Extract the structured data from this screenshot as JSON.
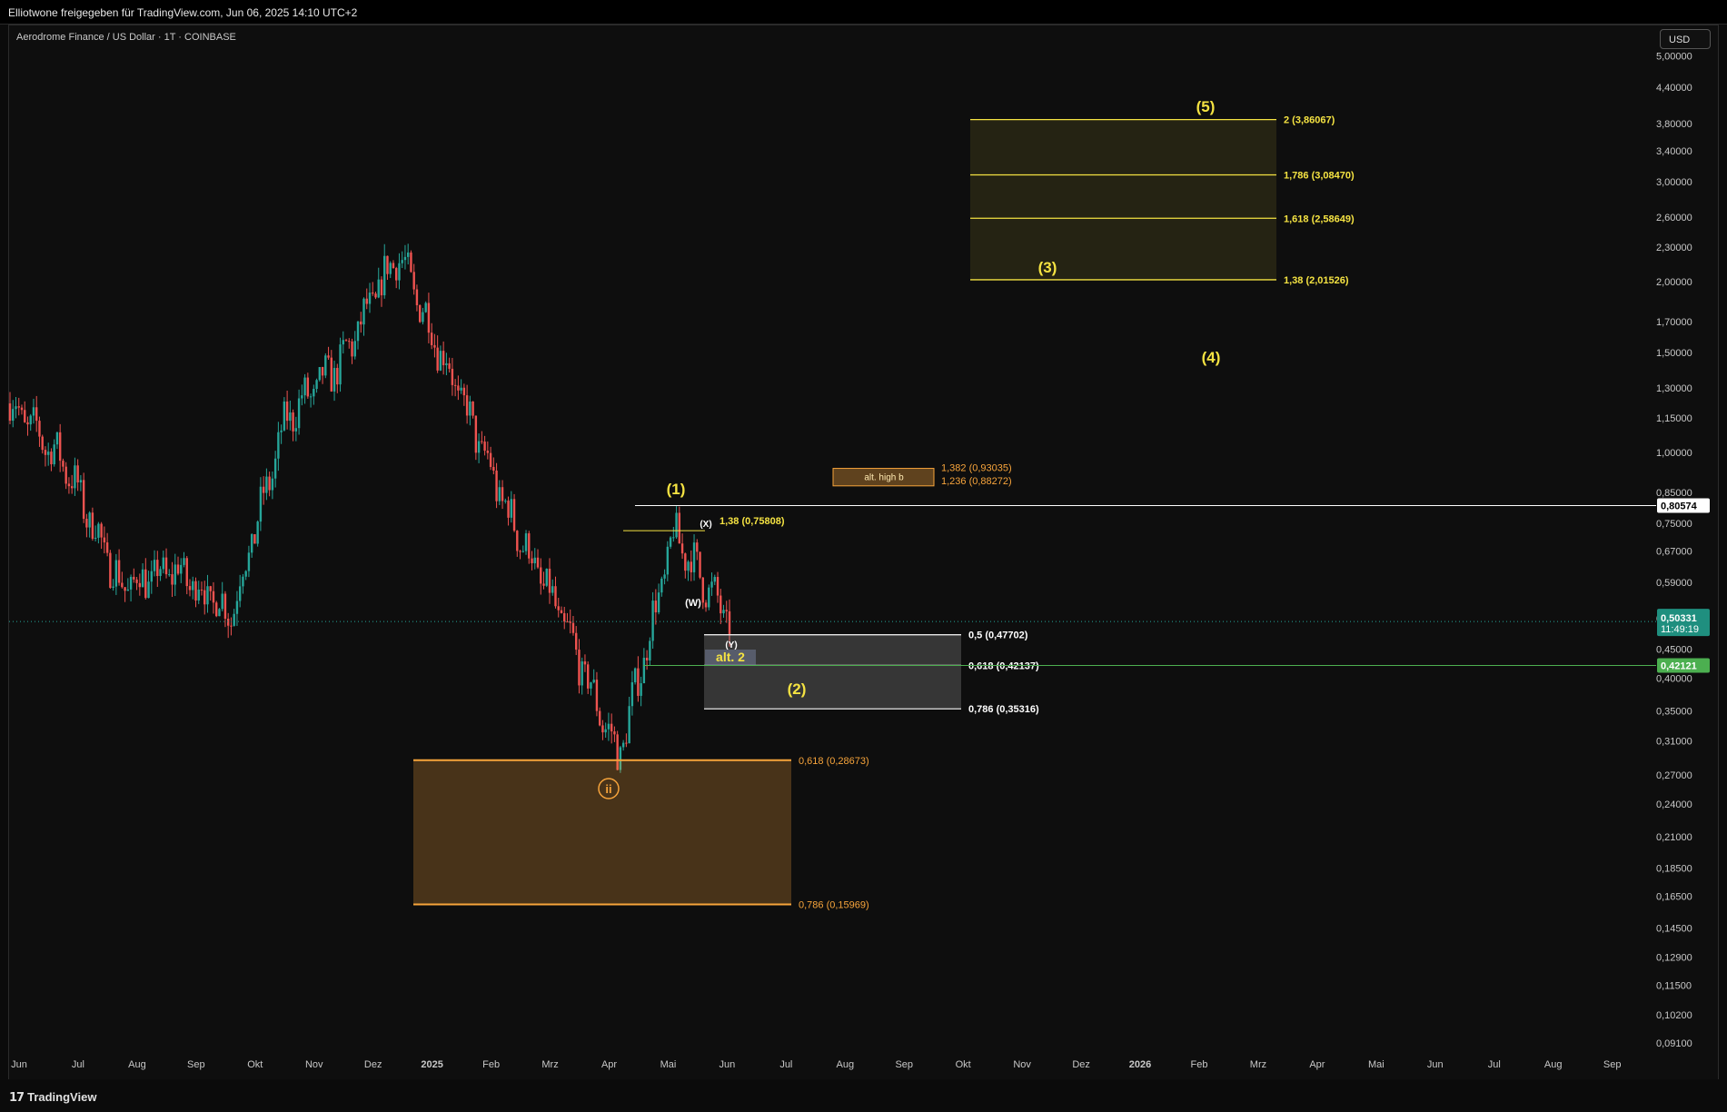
{
  "header": {
    "share_text": "Elliotwone freigegeben für TradingView.com, Jun 06, 2025 14:10 UTC+2"
  },
  "symbol": "Aerodrome Finance / US Dollar · 1T · COINBASE",
  "currency_button": "USD",
  "footer": {
    "brand": "TradingView"
  },
  "colors": {
    "up": "#26a69a",
    "down": "#ef5350",
    "fib_yellow": "#f5e342",
    "fib_orange": "#f7a43b",
    "white": "#ffffff",
    "green": "#4caf50"
  },
  "chart_data": {
    "type": "candlestick",
    "scale": "log",
    "ylim": [
      0.085,
      5.1
    ],
    "x_ticks": [
      "Jun",
      "Jul",
      "Aug",
      "Sep",
      "Okt",
      "Nov",
      "Dez",
      "2025",
      "Feb",
      "Mrz",
      "Apr",
      "Mai",
      "Jun",
      "Jul",
      "Aug",
      "Sep",
      "Okt",
      "Nov",
      "Dez",
      "2026",
      "Feb",
      "Mrz",
      "Apr",
      "Mai",
      "Jun",
      "Jul",
      "Aug",
      "Sep"
    ],
    "y_ticks": [
      "5,00000",
      "4,40000",
      "3,80000",
      "3,40000",
      "3,00000",
      "2,60000",
      "2,30000",
      "2,00000",
      "1,70000",
      "1,50000",
      "1,30000",
      "1,15000",
      "1,00000",
      "0,85000",
      "0,75000",
      "0,67000",
      "0,59000",
      "0,51000",
      "0,45000",
      "0,40000",
      "0,35000",
      "0,31000",
      "0,27000",
      "0,24000",
      "0,21000",
      "0,18500",
      "0,16500",
      "0,14500",
      "0,12900",
      "0,11500",
      "0,10200",
      "0,09100"
    ],
    "y_tick_values": [
      5.0,
      4.4,
      3.8,
      3.4,
      3.0,
      2.6,
      2.3,
      2.0,
      1.7,
      1.5,
      1.3,
      1.15,
      1.0,
      0.85,
      0.75,
      0.67,
      0.59,
      0.51,
      0.45,
      0.4,
      0.35,
      0.31,
      0.27,
      0.24,
      0.21,
      0.185,
      0.165,
      0.145,
      0.129,
      0.115,
      0.102,
      0.091
    ],
    "price_path_months": [
      "Jun",
      "Jul",
      "Aug",
      "Sep",
      "Okt",
      "Nov",
      "Dez",
      "2025",
      "Feb",
      "Mrz",
      "Apr",
      "Mai",
      "Jun"
    ],
    "price_path_values": [
      1.22,
      0.95,
      0.58,
      0.62,
      0.52,
      1.15,
      1.45,
      2.25,
      1.35,
      0.78,
      0.5,
      0.29,
      0.72,
      0.5
    ],
    "last_price": {
      "value": "0,50331",
      "countdown": "11:49:19"
    },
    "labels_right": [
      {
        "text": "0,80574",
        "value": 0.80574,
        "style": "white"
      },
      {
        "text": "0,42121",
        "value": 0.42121,
        "style": "green"
      }
    ],
    "horizontal_lines": [
      {
        "value": 0.80574,
        "color": "#ffffff"
      },
      {
        "value": 0.42121,
        "color": "#4caf50"
      },
      {
        "value": 0.50331,
        "color": "#26a69a",
        "dotted": true
      }
    ],
    "fib_targets_yellow": [
      {
        "label": "2 (3,86067)",
        "value": 3.86067
      },
      {
        "label": "1,786 (3,08470)",
        "value": 3.0847
      },
      {
        "label": "1,618 (2,58649)",
        "value": 2.58649
      },
      {
        "label": "1,38 (2,01526)",
        "value": 2.01526
      }
    ],
    "fib_white": [
      {
        "label": "0,5 (0,47702)",
        "value": 0.47702
      },
      {
        "label": "0,618 (0,42137)",
        "value": 0.42137
      },
      {
        "label": "0,786 (0,35316)",
        "value": 0.35316
      }
    ],
    "fib_orange": [
      {
        "label": "0,618 (0,28673)",
        "value": 0.28673
      },
      {
        "label": "0,786 (0,15969)",
        "value": 0.15969
      }
    ],
    "fib_alt_high": [
      {
        "label": "1,382 (0,93035)",
        "value": 0.93035
      },
      {
        "label": "1,236 (0,88272)",
        "value": 0.88272
      }
    ],
    "alt_high_box_label": "alt. high b",
    "level_138": {
      "label": "1,38 (0,75808)",
      "value": 0.75808
    },
    "wave_labels": [
      {
        "text": "(1)",
        "color": "#f5e342"
      },
      {
        "text": "(2)",
        "color": "#f5e342"
      },
      {
        "text": "(3)",
        "color": "#f5e342"
      },
      {
        "text": "(4)",
        "color": "#f5e342"
      },
      {
        "text": "(5)",
        "color": "#f5e342"
      },
      {
        "text": "(W)",
        "color": "#ffffff"
      },
      {
        "text": "(X)",
        "color": "#ffffff"
      },
      {
        "text": "(Y)",
        "color": "#ffffff"
      },
      {
        "text": "alt. 2",
        "color": "#f5e342"
      },
      {
        "text": "ii",
        "color": "#f7a43b"
      }
    ]
  }
}
